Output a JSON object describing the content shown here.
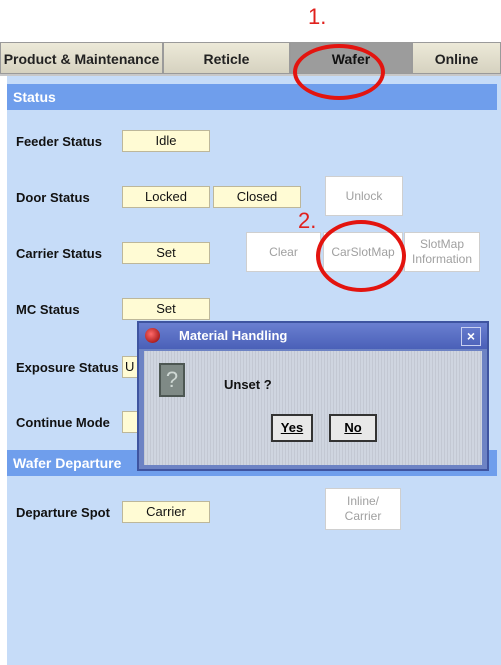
{
  "annotations": {
    "step1": "1.",
    "step2": "2."
  },
  "tabs": [
    {
      "label": "Product & Maintenance"
    },
    {
      "label": "Reticle"
    },
    {
      "label": "Wafer"
    },
    {
      "label": "Online"
    }
  ],
  "status": {
    "header": "Status",
    "feeder": {
      "label": "Feeder Status",
      "value": "Idle"
    },
    "door": {
      "label": "Door Status",
      "value1": "Locked",
      "value2": "Closed",
      "unlock_button": "Unlock"
    },
    "carrier": {
      "label": "Carrier Status",
      "value": "Set",
      "clear_button": "Clear",
      "carslotmap_button": "CarSlotMap",
      "slotmap_info_button_line1": "SlotMap",
      "slotmap_info_button_line2": "Information"
    },
    "mc": {
      "label": "MC Status",
      "value": "Set"
    },
    "exposure": {
      "label": "Exposure Status",
      "value": "U"
    },
    "continue_mode": {
      "label": "Continue Mode"
    }
  },
  "departure": {
    "header": "Wafer Departure",
    "spot_label": "Departure Spot",
    "spot_value": "Carrier",
    "inline_button_line1": "Inline/",
    "inline_button_line2": "Carrier"
  },
  "dialog": {
    "title": "Material Handling",
    "close_glyph": "×",
    "message": "Unset ?",
    "icon_glyph": "?",
    "yes_button": "Yes",
    "no_button": "No"
  },
  "colors": {
    "accent_red": "#e3140f",
    "panel_bg": "#c6dcf8",
    "section_header": "#6f9eec",
    "field_bg": "#fffbd4"
  }
}
